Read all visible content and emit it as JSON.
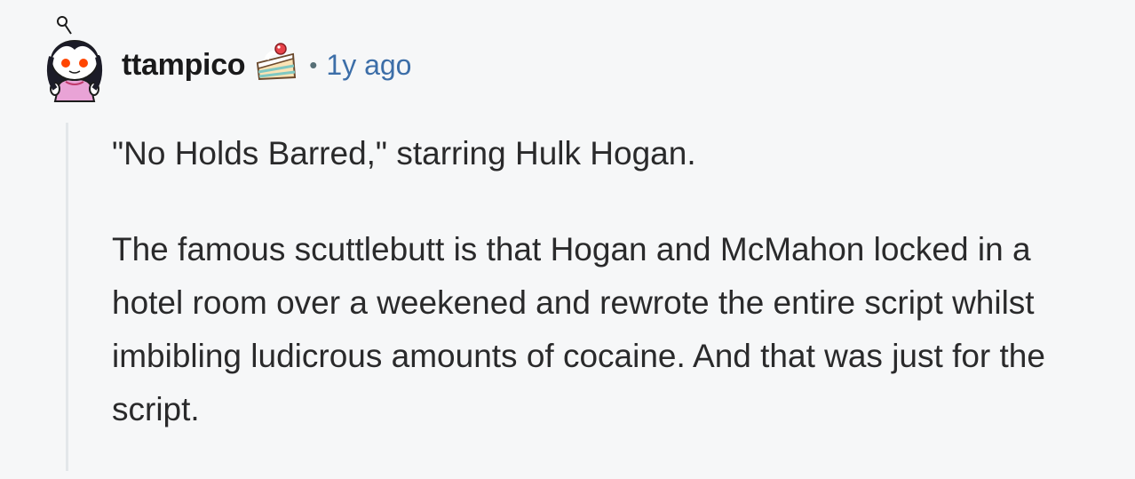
{
  "comment": {
    "author": "ttampico",
    "separator": "•",
    "timestamp": "1y ago",
    "flair_icon": "cake-icon",
    "avatar_icon": "snoo-avatar",
    "paragraphs": [
      "\"No Holds Barred,\" starring Hulk Hogan.",
      "The famous scuttlebutt is that Hogan and McMahon locked in a hotel room over a weekened and rewrote the entire script whilst imbibling ludicrous amounts of cocaine. And that was just for the script."
    ]
  },
  "colors": {
    "background": "#f6f7f8",
    "username": "#1a1a1b",
    "timestamp": "#3c6ea8",
    "thread_line": "#e3e7ea",
    "body_text": "#2a2a2b"
  }
}
